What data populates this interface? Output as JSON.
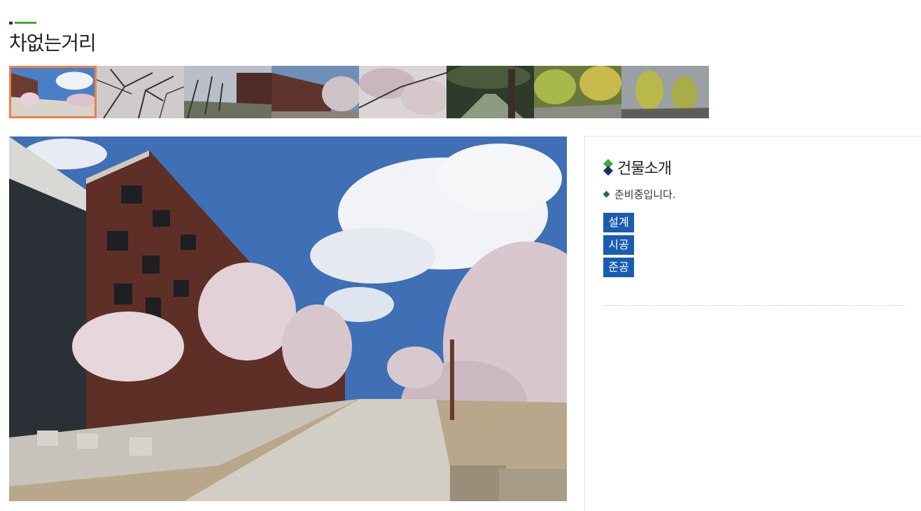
{
  "page": {
    "title": "차없는거리"
  },
  "gallery": {
    "thumbnails": [
      {
        "label": "photo-1",
        "active": true
      },
      {
        "label": "photo-2",
        "active": false
      },
      {
        "label": "photo-3",
        "active": false
      },
      {
        "label": "photo-4",
        "active": false
      },
      {
        "label": "photo-5",
        "active": false
      },
      {
        "label": "photo-6",
        "active": false
      },
      {
        "label": "photo-7",
        "active": false
      },
      {
        "label": "photo-8",
        "active": false
      }
    ]
  },
  "info": {
    "heading": "건물소개",
    "note": "준비중입니다.",
    "tags": [
      "설계",
      "시공",
      "준공"
    ]
  },
  "colors": {
    "accent_green": "#3ea93c",
    "accent_navy": "#1b2f6b",
    "tag_blue": "#1a5cb0",
    "active_border": "#f07d4a"
  }
}
